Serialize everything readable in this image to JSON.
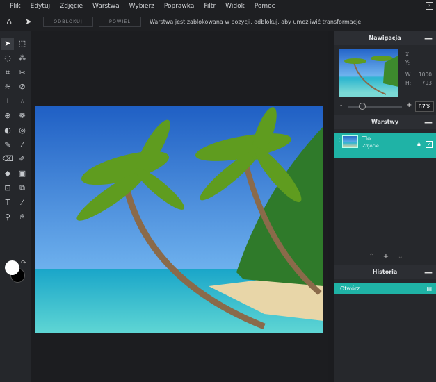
{
  "menu": [
    "Plik",
    "Edytuj",
    "Zdjęcie",
    "Warstwa",
    "Wybierz",
    "Poprawka",
    "Filtr",
    "Widok",
    "Pomoc"
  ],
  "toolbar": {
    "unlock_label": "ODBLOKUJ",
    "duplicate_label": "POWIEL",
    "message": "Warstwa jest zablokowana w pozycji, odblokuj, aby umożliwić transformacje."
  },
  "tools": [
    "move",
    "marquee",
    "lasso",
    "magic-wand",
    "crop",
    "cut",
    "liquify",
    "heal",
    "stamp",
    "drop",
    "sphere",
    "spots",
    "dodge",
    "sponge",
    "pencil",
    "brush",
    "eraser",
    "color-replace",
    "fill",
    "gradient",
    "shape",
    "copy",
    "text",
    "eyedropper",
    "zoom",
    "hand"
  ],
  "navigation": {
    "title": "Nawigacja",
    "x_label": "X:",
    "y_label": "Y:",
    "w_label": "W:",
    "w_value": "1000",
    "h_label": "H:",
    "h_value": "793",
    "zoom": "67%",
    "zoom_minus": "-",
    "zoom_plus": "+"
  },
  "layers": {
    "title": "Warstwy",
    "items": [
      {
        "name": "Tło",
        "type": "Zdjęcie"
      }
    ]
  },
  "history": {
    "title": "Historia",
    "items": [
      "Otwórz"
    ]
  },
  "colors": {
    "accent": "#1fb3a6",
    "foreground": "#ffffff",
    "background": "#000000"
  }
}
